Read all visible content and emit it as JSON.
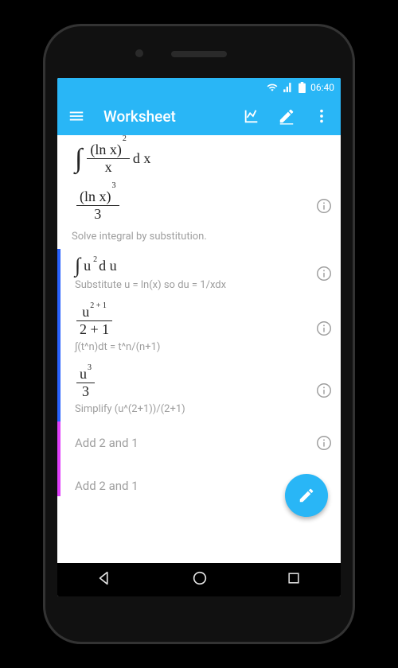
{
  "status": {
    "time": "06:40"
  },
  "appbar": {
    "title": "Worksheet"
  },
  "rows": {
    "r0": {
      "int_sym": "∫",
      "num_base": "(ln x)",
      "num_exp": "2",
      "den": "x",
      "dx": "d x"
    },
    "r1": {
      "num_base": "(ln x)",
      "num_exp": "3",
      "den": "3"
    },
    "cap1": "Solve integral by substitution.",
    "r2": {
      "expr_int": "∫",
      "expr_u": "u",
      "expr_exp": "2",
      "expr_du": "d u",
      "sub": "Substitute u = ln(x) so du = 1/xdx"
    },
    "r3": {
      "num_u": "u",
      "num_exp": "2 + 1",
      "den": "2 + 1",
      "sub": "∫(t^n)dt = t^n/(n+1)"
    },
    "r4": {
      "num_u": "u",
      "num_exp": "3",
      "den": "3",
      "sub": "Simplify (u^(2+1))/(2+1)"
    },
    "r5": "Add 2 and 1",
    "r6": "Add 2 and 1"
  }
}
